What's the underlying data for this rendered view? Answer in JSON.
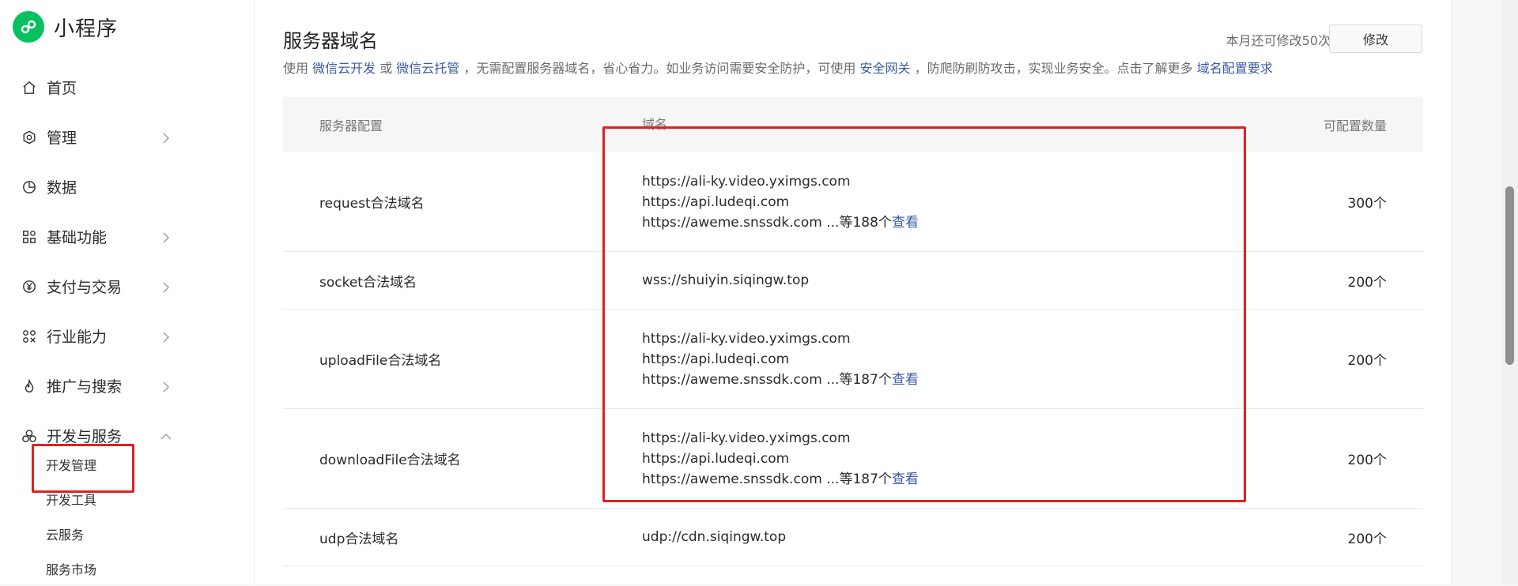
{
  "app": {
    "title": "小程序"
  },
  "sidebar": {
    "items": [
      {
        "label": "首页",
        "icon": "home-icon",
        "chevron": false
      },
      {
        "label": "管理",
        "icon": "settings-icon",
        "chevron": true
      },
      {
        "label": "数据",
        "icon": "chart-icon",
        "chevron": false
      },
      {
        "label": "基础功能",
        "icon": "grid-icon",
        "chevron": true
      },
      {
        "label": "支付与交易",
        "icon": "yen-icon",
        "chevron": true
      },
      {
        "label": "行业能力",
        "icon": "network-icon",
        "chevron": true
      },
      {
        "label": "推广与搜索",
        "icon": "flame-icon",
        "chevron": true
      },
      {
        "label": "开发与服务",
        "icon": "cluster-icon",
        "chevron": true,
        "expanded": true
      }
    ],
    "subitems": [
      {
        "label": "开发管理",
        "active": true
      },
      {
        "label": "开发工具"
      },
      {
        "label": "云服务"
      },
      {
        "label": "服务市场"
      }
    ]
  },
  "main": {
    "title": "服务器域名",
    "quota_text": "本月还可修改50次",
    "modify_label": "修改",
    "desc": {
      "p1": "使用 ",
      "l1": "微信云开发",
      "p2": " 或 ",
      "l2": "微信云托管",
      "p3": " ，无需配置服务器域名，省心省力。如业务访问需要安全防护，可使用 ",
      "l3": "安全网关",
      "p4": " ，防爬防刷防攻击，实现业务安全。点击了解更多 ",
      "l4": "域名配置要求"
    },
    "table": {
      "headers": [
        "服务器配置",
        "域名",
        "可配置数量"
      ],
      "rows": [
        {
          "name": "request合法域名",
          "domains": [
            "https://ali-ky.video.yximgs.com",
            "https://api.ludeqi.com",
            "https://aweme.snssdk.com"
          ],
          "more": "...等188个",
          "view": "查看",
          "count": "300个"
        },
        {
          "name": "socket合法域名",
          "domains": [
            "wss://shuiyin.siqingw.top"
          ],
          "more": "",
          "view": "",
          "count": "200个"
        },
        {
          "name": "uploadFile合法域名",
          "domains": [
            "https://ali-ky.video.yximgs.com",
            "https://api.ludeqi.com",
            "https://aweme.snssdk.com"
          ],
          "more": "...等187个",
          "view": "查看",
          "count": "200个"
        },
        {
          "name": "downloadFile合法域名",
          "domains": [
            "https://ali-ky.video.yximgs.com",
            "https://api.ludeqi.com",
            "https://aweme.snssdk.com"
          ],
          "more": "...等187个",
          "view": "查看",
          "count": "200个"
        },
        {
          "name": "udp合法域名",
          "domains": [
            "udp://cdn.siqingw.top"
          ],
          "more": "",
          "view": "",
          "count": "200个"
        }
      ]
    }
  },
  "colors": {
    "brand": "#07c160",
    "link": "#3b5aa6",
    "annotation": "#e02020"
  }
}
